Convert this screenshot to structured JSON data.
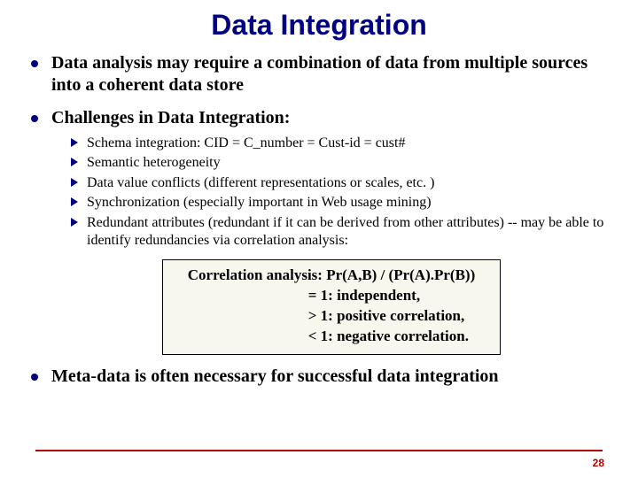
{
  "title": "Data Integration",
  "bullets": {
    "b1": "Data analysis may require a combination of data from multiple sources into a coherent data store",
    "b2": "Challenges in Data Integration:",
    "sub": {
      "s1": "Schema integration: CID = C_number = Cust-id = cust#",
      "s2": "Semantic heterogeneity",
      "s3": "Data value conflicts (different representations or scales, etc. )",
      "s4": "Synchronization (especially important in Web usage mining)",
      "s5": "Redundant attributes (redundant if it can be derived from other attributes) -- may be able to identify redundancies via correlation analysis:"
    },
    "b3": "Meta-data is often necessary for successful data integration"
  },
  "callout": {
    "line1": "Correlation analysis:  Pr(A,B) / (Pr(A).Pr(B))",
    "line2": "= 1: independent,",
    "line3": "> 1: positive correlation,",
    "line4": "< 1: negative correlation."
  },
  "page": "28"
}
